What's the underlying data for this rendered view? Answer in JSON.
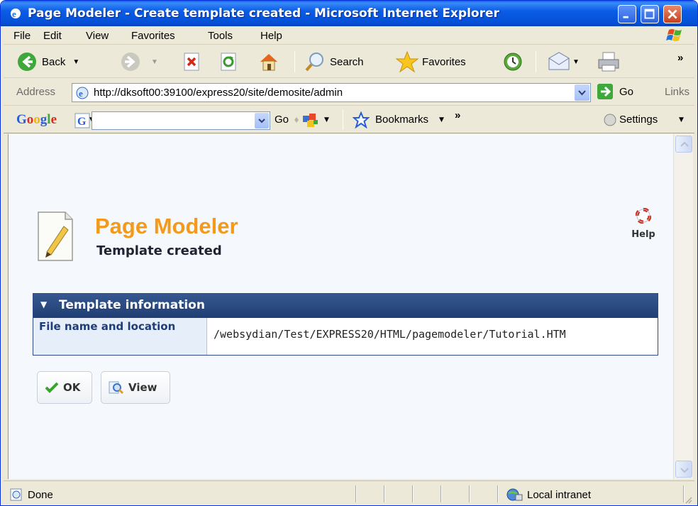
{
  "window": {
    "title": "Page Modeler - Create template created - Microsoft Internet Explorer"
  },
  "menu": {
    "items": [
      "File",
      "Edit",
      "View",
      "Favorites",
      "Tools",
      "Help"
    ]
  },
  "toolbar": {
    "back_label": "Back",
    "search_label": "Search",
    "favorites_label": "Favorites",
    "overflow": "»"
  },
  "address": {
    "label": "Address",
    "url": "http://dksoft00:39100/express20/site/demosite/admin",
    "go_label": "Go",
    "links_label": "Links"
  },
  "google_bar": {
    "logo": "Google",
    "go_label": "Go",
    "bookmarks_label": "Bookmarks",
    "overflow": "»",
    "settings_label": "Settings"
  },
  "page": {
    "title": "Page Modeler",
    "subtitle": "Template created",
    "help_label": "Help",
    "panel_title": "Template information",
    "row_label": "File name and location",
    "row_value": "/websydian/Test/EXPRESS20/HTML/pagemodeler/Tutorial.HTM",
    "ok_label": "OK",
    "view_label": "View"
  },
  "status": {
    "text": "Done",
    "zone": "Local intranet"
  },
  "colors": {
    "title_bar": "#0b5ce6",
    "brand_orange": "#f39a1b",
    "panel_header": "#2b4a82",
    "label_text": "#1f3d78"
  }
}
